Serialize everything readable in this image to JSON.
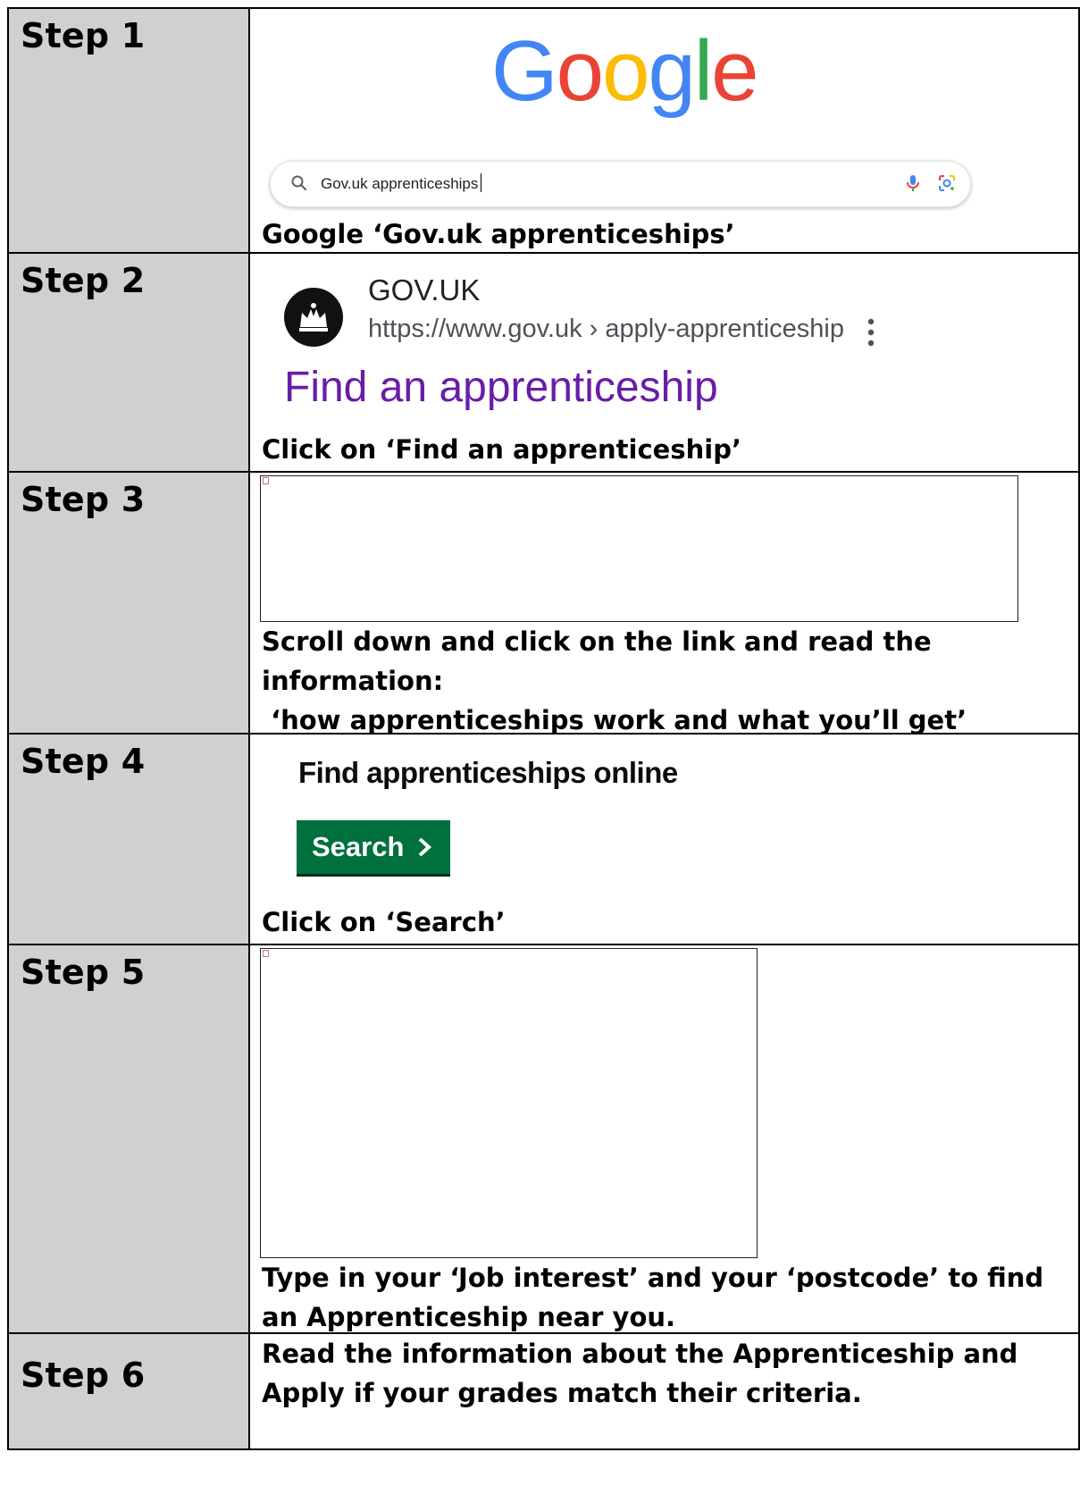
{
  "steps": [
    {
      "label": "Step 1",
      "caption": "Google ‘Gov.uk apprenticeships’"
    },
    {
      "label": "Step 2",
      "caption": "Click on ‘Find an apprenticeship’"
    },
    {
      "label": "Step 3",
      "caption_line1": "Scroll down and click on the link and read the",
      "caption_line2": "information:",
      "caption_line3": " ‘how apprenticeships work and what you’ll get’"
    },
    {
      "label": "Step 4",
      "caption": "Click on ‘Search’"
    },
    {
      "label": "Step 5",
      "caption_line1": "Type in your ‘Job interest’ and your ‘postcode’ to find",
      "caption_line2": "an Apprenticeship near you."
    },
    {
      "label": "Step 6",
      "caption_line1": "Read the information about the Apprenticeship and",
      "caption_line2": "Apply if your grades match their criteria."
    }
  ],
  "google": {
    "logo_letters": [
      "G",
      "o",
      "o",
      "g",
      "l",
      "e"
    ],
    "logo_colors": [
      "#4285F4",
      "#EA4335",
      "#FBBC05",
      "#4285F4",
      "#34A853",
      "#EA4335"
    ],
    "search_value": "Gov.uk apprenticeships"
  },
  "result": {
    "site_name": "GOV.UK",
    "url": "https://www.gov.uk › apply-apprenticeship",
    "title": "Find an apprenticeship",
    "title_color": "#681da8"
  },
  "govuk": {
    "heading": "Find apprenticeships online",
    "button_label": "Search",
    "button_color": "#00703c"
  },
  "colors": {
    "label_column": "#d0d0d0"
  }
}
